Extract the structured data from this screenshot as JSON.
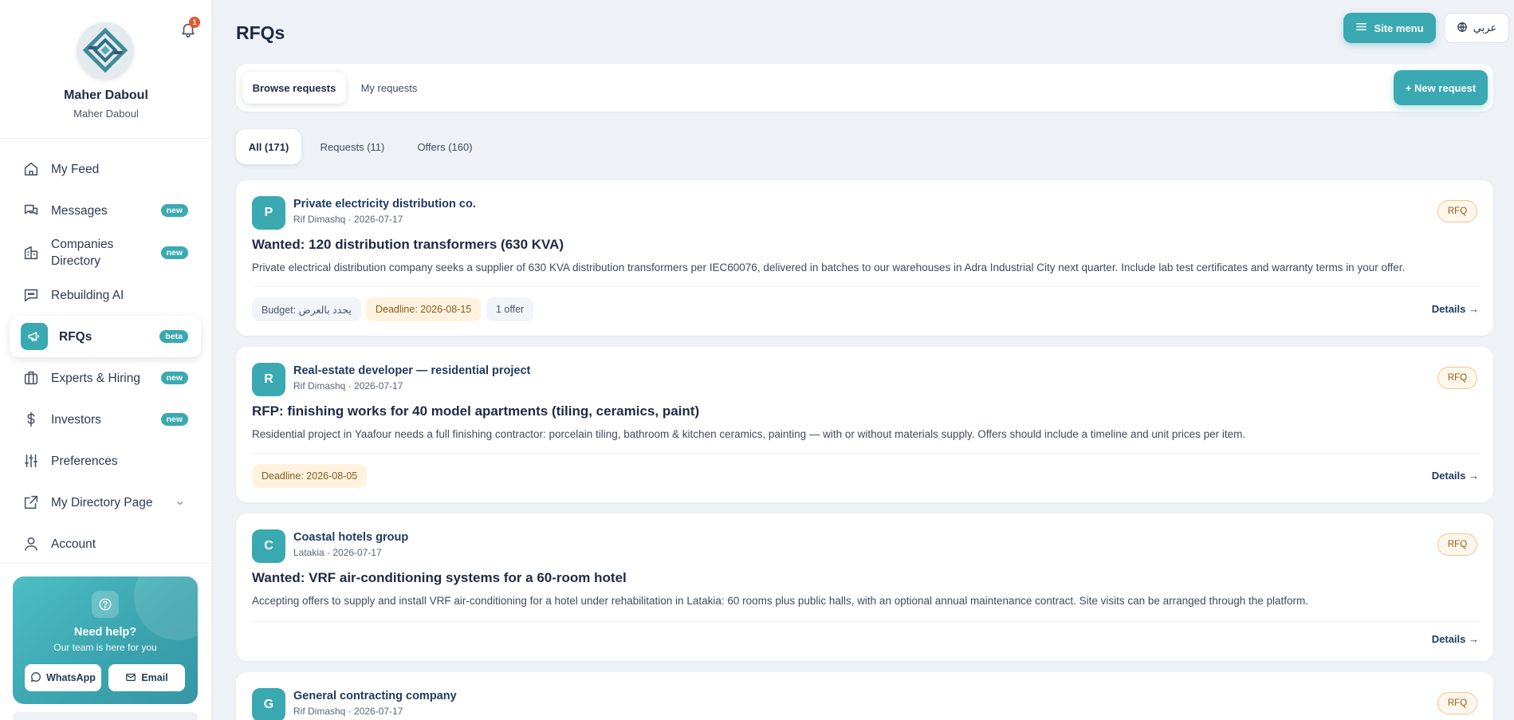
{
  "profile": {
    "name": "Maher Daboul",
    "subtitle": "Maher Daboul",
    "notifications_count": "1"
  },
  "sidebar": {
    "items": [
      {
        "label": "My Feed",
        "icon": "home-icon"
      },
      {
        "label": "Messages",
        "badge": "new",
        "icon": "chat-icon"
      },
      {
        "label": "Companies Directory",
        "badge": "new",
        "icon": "building-icon"
      },
      {
        "label": "Rebuilding AI",
        "icon": "ai-chat-icon"
      },
      {
        "label": "RFQs",
        "badge": "beta",
        "icon": "megaphone-icon",
        "active": true
      },
      {
        "label": "Experts & Hiring",
        "badge": "new",
        "icon": "briefcase-icon"
      },
      {
        "label": "Investors",
        "badge": "new",
        "icon": "dollar-icon"
      },
      {
        "label": "Preferences",
        "icon": "sliders-icon"
      },
      {
        "label": "My Directory Page",
        "icon": "external-link-icon"
      },
      {
        "label": "Account",
        "icon": "user-icon"
      }
    ]
  },
  "help": {
    "title": "Need help?",
    "subtitle": "Our team is here for you",
    "whatsapp_label": "WhatsApp",
    "email_label": "Email"
  },
  "header": {
    "title": "RFQs",
    "site_menu_label": "Site menu",
    "language_label": "عربي"
  },
  "tabs": {
    "browse": "Browse requests",
    "mine": "My requests",
    "new_request": "+ New request"
  },
  "filters": {
    "all": "All (171)",
    "requests": "Requests (11)",
    "offers": "Offers (160)"
  },
  "cards": [
    {
      "initial": "P",
      "org": "Private electricity distribution co.",
      "meta": "Rif Dimashq · 2026-07-17",
      "tag": "RFQ",
      "title": "Wanted: 120 distribution transformers (630 KVA)",
      "desc": "Private electrical distribution company seeks a supplier of 630 KVA distribution transformers per IEC60076, delivered in batches to our warehouses in Adra Industrial City next quarter. Include lab test certificates and warranty terms in your offer.",
      "budget": "Budget: يحدد بالعرض",
      "deadline": "Deadline: 2026-08-15",
      "offers": "1 offer",
      "details": "Details →"
    },
    {
      "initial": "R",
      "org": "Real-estate developer — residential project",
      "meta": "Rif Dimashq · 2026-07-17",
      "tag": "RFQ",
      "title": "RFP: finishing works for 40 model apartments (tiling, ceramics, paint)",
      "desc": "Residential project in Yaafour needs a full finishing contractor: porcelain tiling, bathroom & kitchen ceramics, painting — with or without materials supply. Offers should include a timeline and unit prices per item.",
      "deadline": "Deadline: 2026-08-05",
      "details": "Details →"
    },
    {
      "initial": "C",
      "org": "Coastal hotels group",
      "meta": "Latakia · 2026-07-17",
      "tag": "RFQ",
      "title": "Wanted: VRF air-conditioning systems for a 60-room hotel",
      "desc": "Accepting offers to supply and install VRF air-conditioning for a hotel under rehabilitation in Latakia: 60 rooms plus public halls, with an optional annual maintenance contract. Site visits can be arranged through the platform.",
      "details": "Details →"
    },
    {
      "initial": "G",
      "org": "General contracting company",
      "meta": "Rif Dimashq · 2026-07-17",
      "tag": "RFQ"
    }
  ],
  "colors": {
    "accent": "#3aa9b1",
    "background": "#eef1f6",
    "badge_red": "#e4572e",
    "rfq_tag_border": "#f3c48e"
  }
}
